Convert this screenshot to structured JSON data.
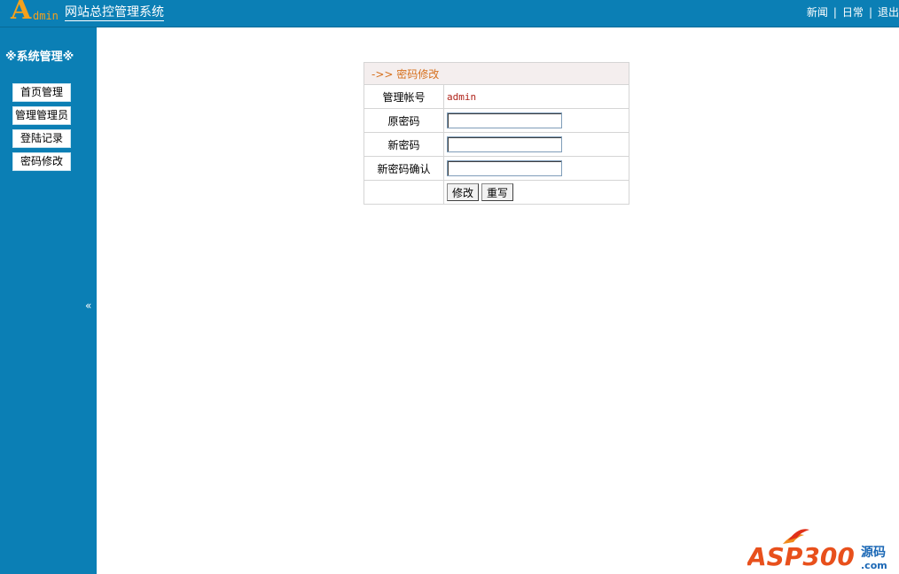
{
  "header": {
    "logo_a": "A",
    "logo_dmin": "dmin",
    "title": "网站总控管理系统",
    "nav": [
      "新闻",
      "日常",
      "退出"
    ],
    "nav_sep": "|"
  },
  "sidebar": {
    "title": "※系统管理※",
    "items": [
      "首页管理",
      "管理管理员",
      "登陆记录",
      "密码修改"
    ],
    "collapse_icon": "«"
  },
  "panel": {
    "title": "->> 密码修改",
    "rows": {
      "account_label": "管理帐号",
      "account_value": "admin",
      "old_label": "原密码",
      "new_label": "新密码",
      "confirm_label": "新密码确认"
    },
    "buttons": {
      "submit": "修改",
      "reset": "重写"
    }
  },
  "watermark": {
    "brand": "ASP300",
    "suffix": "源码",
    "domain": ".com"
  },
  "colors": {
    "primary": "#0b7fb5",
    "logo": "#f4a11d",
    "panel_title": "#d6711f",
    "account": "#b0241b"
  }
}
